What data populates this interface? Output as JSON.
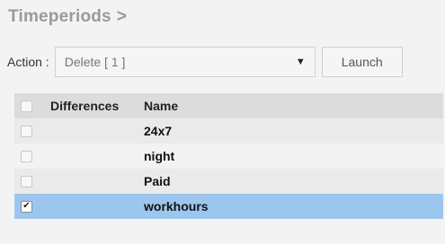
{
  "header": {
    "title": "Timeperiods",
    "title_separator": ">"
  },
  "action_bar": {
    "label": "Action :",
    "selected_action": "Delete [ 1 ]",
    "launch_label": "Launch"
  },
  "table": {
    "columns": [
      "Differences",
      "Name"
    ],
    "rows": [
      {
        "name": "24x7",
        "checked": false
      },
      {
        "name": "night",
        "checked": false
      },
      {
        "name": "Paid",
        "checked": false
      },
      {
        "name": "workhours",
        "checked": true
      }
    ]
  },
  "colors": {
    "selected_row": "#9cc6ee",
    "header_bg": "#dcdcdc",
    "title_text": "#9a9a9a"
  },
  "icons": {
    "dropdown": "caret-down-icon",
    "check": "checkmark-icon"
  }
}
